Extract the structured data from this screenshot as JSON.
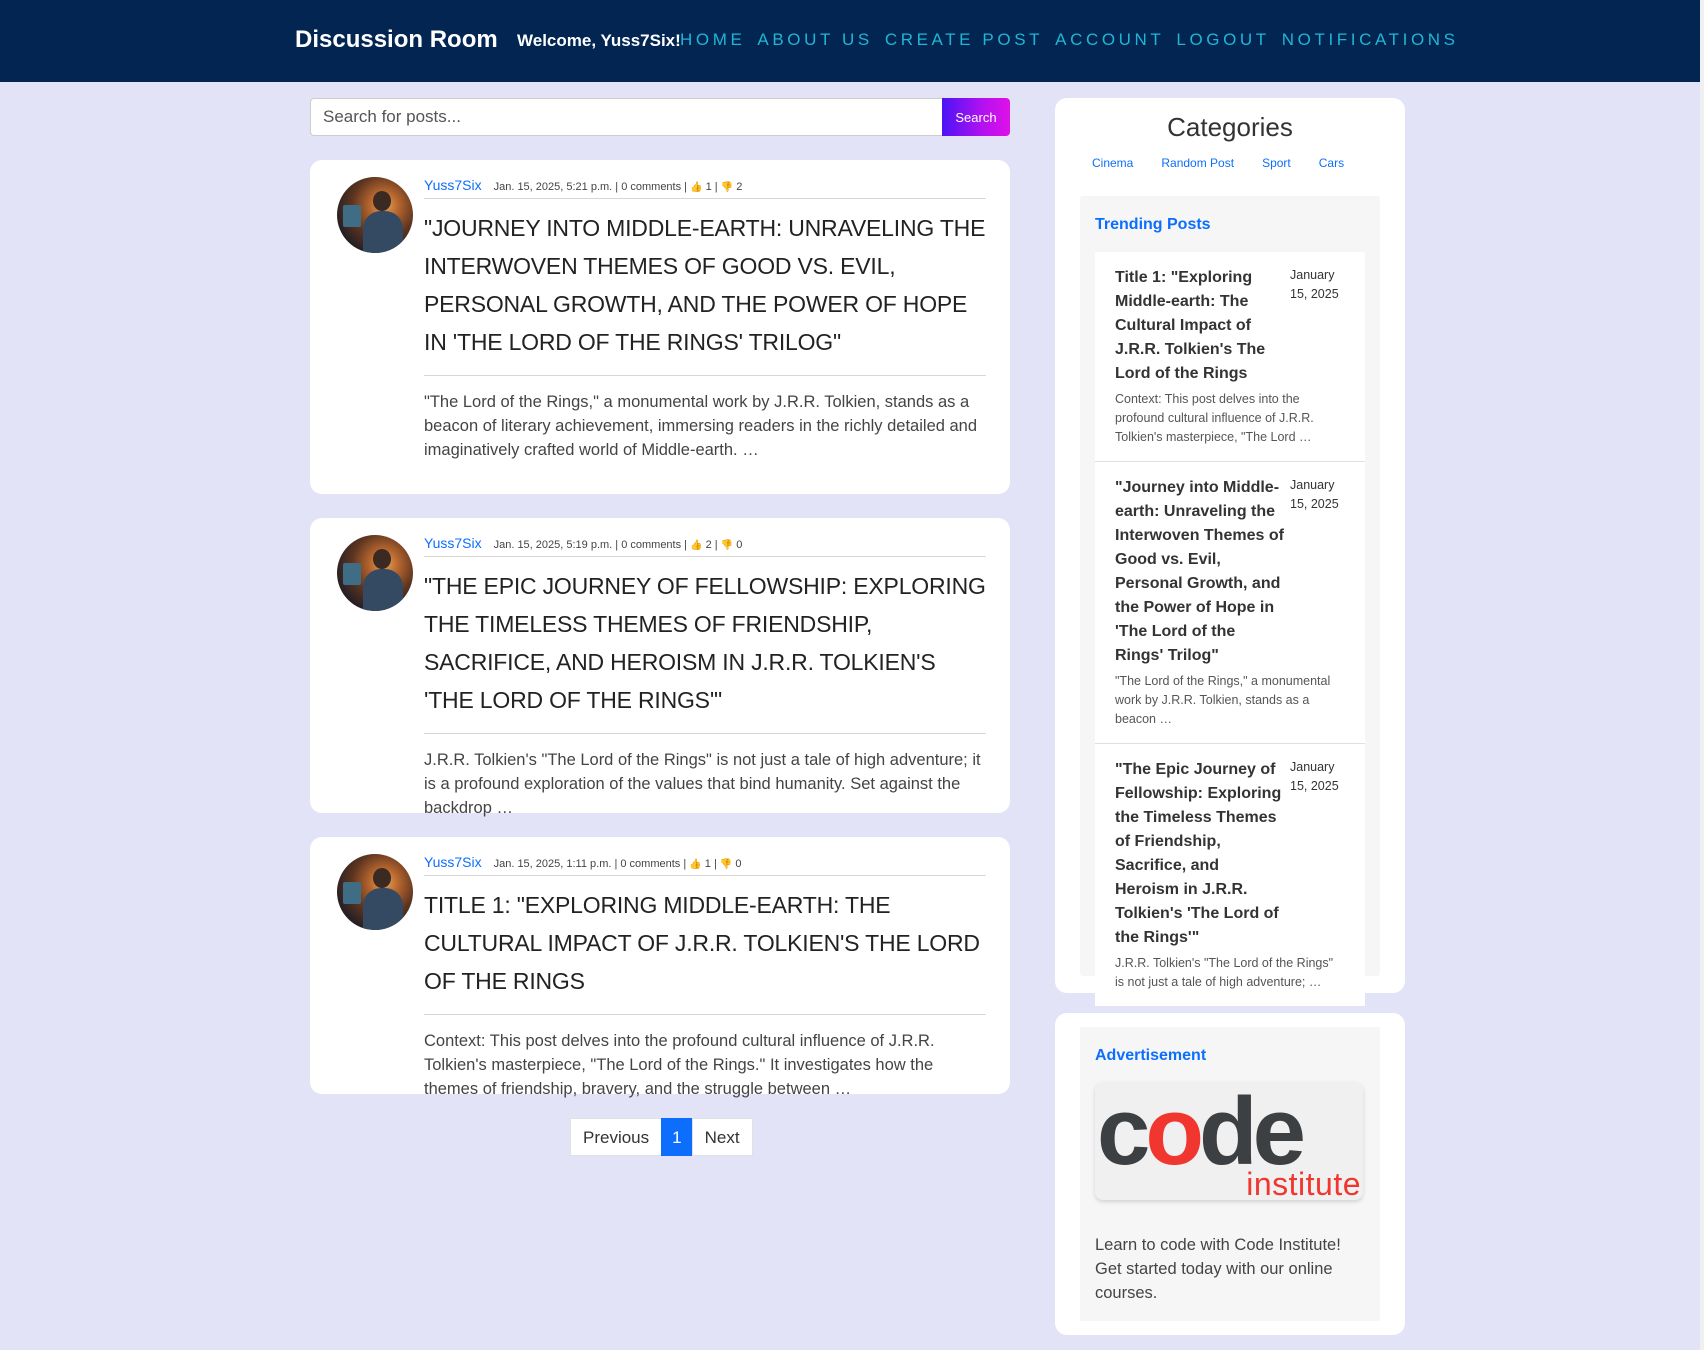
{
  "navbar": {
    "brand": "Discussion Room",
    "welcome": "Welcome, Yuss7Six!",
    "links": [
      "HOME",
      "ABOUT US",
      "CREATE POST",
      "ACCOUNT",
      "LOGOUT",
      "NOTIFICATIONS"
    ]
  },
  "search": {
    "placeholder": "Search for posts...",
    "button_label": "Search"
  },
  "posts": [
    {
      "author": "Yuss7Six",
      "meta_prefix": "Jan. 15, 2025, 5:21 p.m. | 0 comments | ",
      "likes": "1",
      "dislikes": "2",
      "title": "\"Journey into Middle-earth: Unraveling the Interwoven Themes of Good vs. Evil, Personal Growth, and the Power of Hope in 'The Lord of the Rings' Trilog\"",
      "excerpt": "\"The Lord of the Rings,\" a monumental work by J.R.R. Tolkien, stands as a beacon of literary achievement, immersing readers in the richly detailed and imaginatively crafted world of Middle-earth. …"
    },
    {
      "author": "Yuss7Six",
      "meta_prefix": "Jan. 15, 2025, 5:19 p.m. | 0 comments | ",
      "likes": "2",
      "dislikes": "0",
      "title": "\"The Epic Journey of Fellowship: Exploring the Timeless Themes of Friendship, Sacrifice, and Heroism in J.R.R. Tolkien's 'The Lord of the Rings'\"",
      "excerpt": "J.R.R. Tolkien's \"The Lord of the Rings\" is not just a tale of high adventure; it is a profound exploration of the values that bind humanity. Set against the backdrop …"
    },
    {
      "author": "Yuss7Six",
      "meta_prefix": "Jan. 15, 2025, 1:11 p.m. | 0 comments | ",
      "likes": "1",
      "dislikes": "0",
      "title": "Title 1: \"Exploring Middle-earth: The Cultural Impact of J.R.R. Tolkien's The Lord of the Rings",
      "excerpt": "Context: This post delves into the profound cultural influence of J.R.R. Tolkien's masterpiece, \"The Lord of the Rings.\" It investigates how the themes of friendship, bravery, and the struggle between …"
    }
  ],
  "pagination": {
    "previous": "Previous",
    "current": "1",
    "next": "Next"
  },
  "categories": {
    "title": "Categories",
    "items": [
      "Cinema",
      "Random Post",
      "Sport",
      "Cars"
    ]
  },
  "trending": {
    "title": "Trending Posts",
    "items": [
      {
        "title": "Title 1: \"Exploring Middle-earth: The Cultural Impact of J.R.R. Tolkien's The Lord of the Rings",
        "date": "January 15, 2025",
        "excerpt": "Context: This post delves into the profound cultural influence of J.R.R. Tolkien's masterpiece, \"The Lord …"
      },
      {
        "title": "\"Journey into Middle-earth: Unraveling the Interwoven Themes of Good vs. Evil, Personal Growth, and the Power of Hope in 'The Lord of the Rings' Trilog\"",
        "date": "January 15, 2025",
        "excerpt": "\"The Lord of the Rings,\" a monumental work by J.R.R. Tolkien, stands as a beacon …"
      },
      {
        "title": "\"The Epic Journey of Fellowship: Exploring the Timeless Themes of Friendship, Sacrifice, and Heroism in J.R.R. Tolkien's 'The Lord of the Rings'\"",
        "date": "January 15, 2025",
        "excerpt": "J.R.R. Tolkien's \"The Lord of the Rings\" is not just a tale of high adventure; …"
      }
    ]
  },
  "advertisement": {
    "title": "Advertisement",
    "logo_word": "code",
    "logo_sub": "institute",
    "text": "Learn to code with Code Institute! Get started today with our online courses."
  },
  "colors": {
    "navbar_bg": "#032552",
    "nav_link": "#1fb6d6",
    "page_bg": "#e3e3f7",
    "accent_blue": "#0d6efd",
    "logo_red": "#f0362e"
  }
}
